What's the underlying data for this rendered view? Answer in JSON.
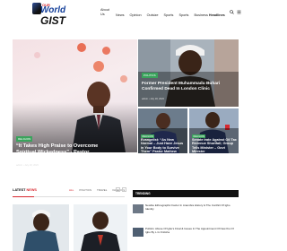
{
  "brand": {
    "line1": "OUR",
    "line2": "World",
    "line3": "GIST"
  },
  "nav": {
    "items": [
      "About Us",
      "News",
      "Entertainment",
      "Opinion",
      "Outside",
      "Sports",
      "Sports",
      "Business & Politics",
      "Headlines"
    ],
    "display": [
      "About Us",
      "News",
      "Entertai...",
      "Opinion",
      "Outsize",
      "Sports",
      "Sports",
      "Business",
      "Headlines"
    ]
  },
  "hero": {
    "category": "RELIGION",
    "title": "“It Takes High Praise to Overcome Spiritual Wickedness” - Pastor Mathew",
    "meta": "admin  •  July 18, 2023"
  },
  "card_top": {
    "category": "POLITICS",
    "title": "Former President Muhammadu Buhari Confirmed Dead In London Clinic",
    "meta": "admin  •  July 18, 2023"
  },
  "card_a": {
    "category": "RELIGION",
    "title": "Evangelist: “As New Normal – Just Have Jesus in Your Body to Survive Them” Pastor Mathew"
  },
  "card_b": {
    "category": "RELIGION",
    "title": "Senate Irate Against Oil Tax Revenue Shortfall; Group Tells Minister – Govt Minister"
  },
  "latest": {
    "label_1": "LATEST",
    "label_2": "NEWS",
    "tabs": [
      "ALL",
      "POLITICS",
      "TRAVEL",
      "FASHION"
    ],
    "pager": [
      "‹",
      "›"
    ]
  },
  "trending": {
    "title": "TRENDING",
    "items": [
      {
        "text": "Newbie Ethnographic Factor In Anambra History & The Conflict Of Igbo Identity",
        "meta": "admin  •  July 18, 2023"
      },
      {
        "text": "Politics: Abuse Of Igbo's Final & Issues In The Appointment Of New Ibo Of Igbo By L.G Onitsha",
        "meta": "admin  •  July 18, 2023"
      }
    ]
  },
  "colors": {
    "accent": "#d7282f",
    "brand_blue": "#15409a",
    "category": "#3aa35c"
  }
}
